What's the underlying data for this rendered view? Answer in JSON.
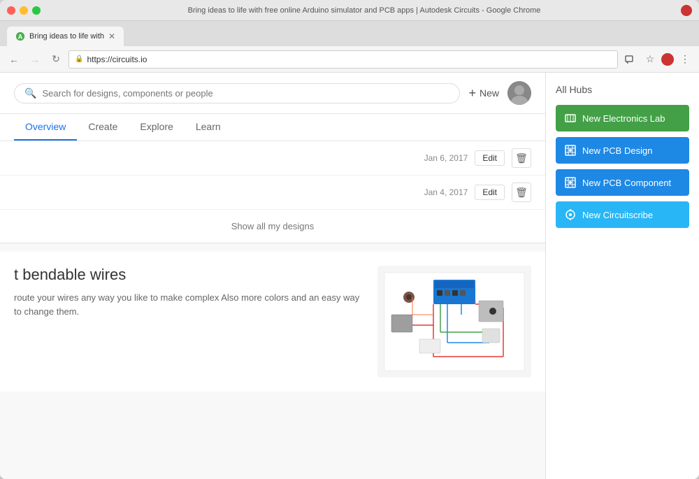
{
  "window": {
    "title": "Bring ideas to life with free online Arduino simulator and PCB apps | Autodesk Circuits - Google Chrome",
    "tab_label": "Bring ideas to life with",
    "url": "https://circuits.io"
  },
  "nav": {
    "back_label": "←",
    "forward_label": "→",
    "refresh_label": "↻"
  },
  "header": {
    "search_placeholder": "Search for designs, components or people",
    "new_label": "New"
  },
  "app_nav": {
    "items": [
      {
        "label": "Overview",
        "active": true
      },
      {
        "label": "Create",
        "active": false
      },
      {
        "label": "Explore",
        "active": false
      },
      {
        "label": "Learn",
        "active": false
      }
    ]
  },
  "designs": {
    "rows": [
      {
        "date": "Jan 6, 2017",
        "edit": "Edit"
      },
      {
        "date": "Jan 4, 2017",
        "edit": "Edit"
      }
    ],
    "show_all": "Show all my designs"
  },
  "promo": {
    "title": "t bendable wires",
    "desc": "route your wires any way you like to make complex\nAlso more colors and an easy way to change them."
  },
  "sidebar": {
    "title": "All Hubs",
    "buttons": [
      {
        "label": "New Electronics Lab",
        "color": "btn-electronics"
      },
      {
        "label": "New PCB Design",
        "color": "btn-pcb"
      },
      {
        "label": "New PCB Component",
        "color": "btn-component"
      },
      {
        "label": "New Circuitscribe",
        "color": "btn-circuitscribe"
      }
    ]
  }
}
